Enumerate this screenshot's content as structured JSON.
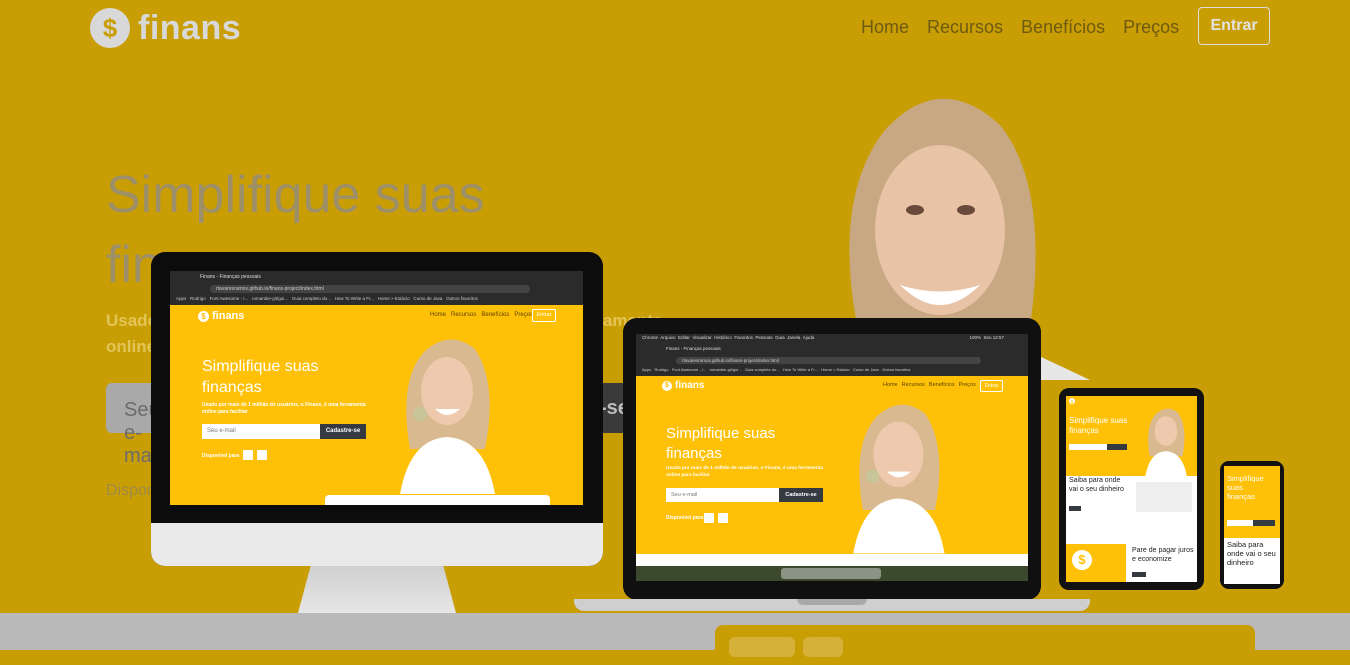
{
  "brand": {
    "name": "finans",
    "icon": "dollar-coin-icon"
  },
  "nav": {
    "items": [
      "Home",
      "Recursos",
      "Benefícios",
      "Preços"
    ],
    "cta": "Entrar"
  },
  "hero": {
    "title": "Simplifique suas finanças",
    "subtitle": "Usado por mais de 1 milhão de usuários, o Finans, é uma ferramenta online para facilitar",
    "email_placeholder": "Seu e-mail",
    "signup_label": "Cadastre-se",
    "available_label": "Disponível para"
  },
  "desktop_screen": {
    "tab_title": "Finans - Finanças pessoais",
    "url": "rtavaresramos.github.io/finans-project/index.html",
    "bookmarks": [
      "Apps",
      "Rodrigo",
      "Font Awesome - I...",
      "romanbie-git/gui...",
      "Guia completo do...",
      "How To Write a Fr...",
      "Home > Estácio",
      "Curso de Java",
      "Outros favoritos"
    ]
  },
  "mac_menu": [
    "Chrome",
    "Arquivo",
    "Editar",
    "Visualizar",
    "Histórico",
    "Favoritos",
    "Pessoas",
    "Guia",
    "Janela",
    "Ajuda"
  ],
  "mac_status": {
    "battery": "100%",
    "clock": "Seu 12:57"
  },
  "tablet_screen": {
    "section_title": "Saiba para onde vai o seu dinheiro",
    "section2_title": "Pare de pagar juros e economize"
  },
  "phone_screen": {
    "section_title": "Saiba para onde vai o seu dinheiro"
  },
  "colors": {
    "brand_yellow": "#ffc107",
    "dark_button": "#343a40",
    "overlay_yellow": "#c99e05"
  }
}
